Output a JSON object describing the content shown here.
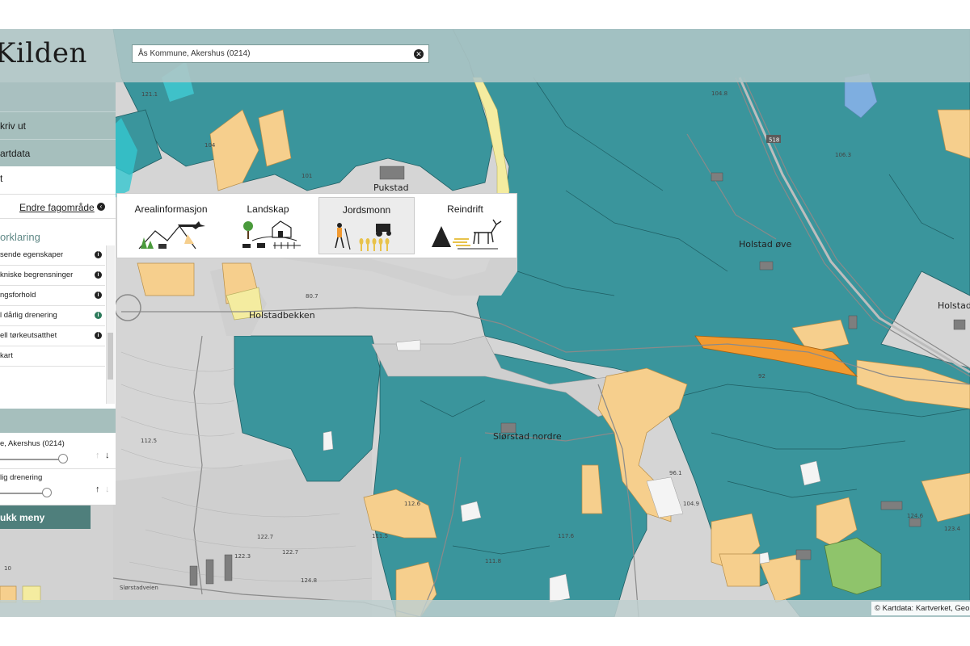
{
  "app": {
    "title": "Kilden"
  },
  "search": {
    "value": "Ås Kommune, Akershus (0214)"
  },
  "sidebar": {
    "items": [
      {
        "label": "kriv ut"
      },
      {
        "label": "artdata"
      },
      {
        "label": "t"
      }
    ],
    "endre_label": "Endre fagområde",
    "tegnforklaring": "orklaring",
    "legend_items": [
      {
        "label": "sende egenskaper",
        "info_icon": "info-icon"
      },
      {
        "label": "kniske begrensninger",
        "info_icon": "info-icon"
      },
      {
        "label": "ngsforhold",
        "info_icon": "info-icon"
      },
      {
        "label": "l dårlig drenering",
        "info_icon": "info-icon-green"
      },
      {
        "label": "ell tørkeutsatthet",
        "info_icon": "info-icon"
      },
      {
        "label": "kart",
        "info_icon": ""
      }
    ],
    "active_layers": [
      {
        "name": "e, Akershus (0214)",
        "opacity": 0.78
      },
      {
        "name": "lig drenering",
        "opacity": 0.58
      }
    ],
    "close_menu": "ukk meny"
  },
  "fagomrader": {
    "tiles": [
      {
        "label": "Arealinformasjon",
        "icon": "airplane-landscape-icon",
        "active": false
      },
      {
        "label": "Landskap",
        "icon": "farm-landscape-icon",
        "active": false
      },
      {
        "label": "Jordsmonn",
        "icon": "soil-tractor-icon",
        "active": true
      },
      {
        "label": "Reindrift",
        "icon": "reindeer-tent-icon",
        "active": false
      }
    ]
  },
  "map": {
    "place_names": [
      "Pukstad",
      "Holstad øve",
      "Holstad",
      "Holstadbekken",
      "Slørstad nordre",
      "Slørstadveien"
    ],
    "route_number": "518",
    "spot_heights": [
      "121.1",
      "104",
      "101",
      "80.7",
      "112.5",
      "111.5",
      "122.7",
      "122.7",
      "124.8",
      "122.3",
      "117.6",
      "111.8",
      "106.3",
      "96.1",
      "104.9",
      "124.6",
      "123.4",
      "104.8",
      "92",
      "112.6",
      "10"
    ],
    "colors": {
      "teal": "#3a959c",
      "light_orange": "#f6cf8d",
      "orange": "#f29a30",
      "green": "#8fc46b",
      "yellow": "#f4eca0",
      "background": "#d5d5d5",
      "water": "#7eaee0"
    }
  },
  "attribution": "Kartdata: Kartverket, Geo"
}
